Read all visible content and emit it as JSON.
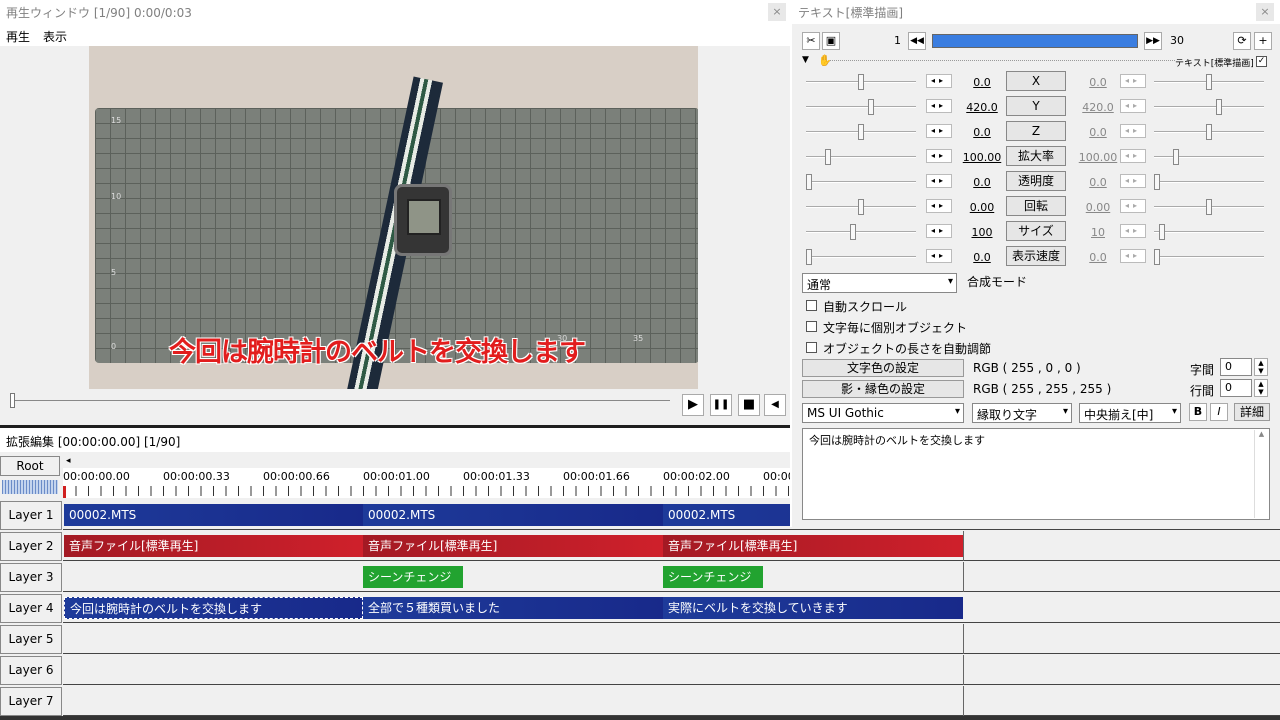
{
  "play_window": {
    "title": "再生ウィンドウ [1/90]  0:00/0:03",
    "close": "×",
    "menu": [
      "再生",
      "表示"
    ],
    "subtitle": "今回は腕時計のベルトを交換します",
    "controls": {
      "play": "▶",
      "pause": "❚❚",
      "stop": "■",
      "sound": "◀"
    }
  },
  "text_panel": {
    "title": "テキスト[標準描画]",
    "close": "×",
    "frame_start": "1",
    "frame_end": "30",
    "object_label": "テキスト[標準描画]",
    "params": [
      {
        "label": "X",
        "value": "0.0",
        "value2": "0.0",
        "level": 0.5,
        "level2": 0.5
      },
      {
        "label": "Y",
        "value": "420.0",
        "value2": "420.0",
        "level": 0.6,
        "level2": 0.6
      },
      {
        "label": "Z",
        "value": "0.0",
        "value2": "0.0",
        "level": 0.5,
        "level2": 0.5
      },
      {
        "label": "拡大率",
        "value": "100.00",
        "value2": "100.00",
        "level": 0.18,
        "level2": 0.18
      },
      {
        "label": "透明度",
        "value": "0.0",
        "value2": "0.0",
        "level": 0.0,
        "level2": 0.0
      },
      {
        "label": "回転",
        "value": "0.00",
        "value2": "0.00",
        "level": 0.5,
        "level2": 0.5
      },
      {
        "label": "サイズ",
        "value": "100",
        "value2": "10",
        "level": 0.42,
        "level2": 0.05
      },
      {
        "label": "表示速度",
        "value": "0.0",
        "value2": "0.0",
        "level": 0.0,
        "level2": 0.0
      }
    ],
    "blend_mode": "通常",
    "blend_mode_label": "合成モード",
    "checkboxes": [
      "自動スクロール",
      "文字毎に個別オブジェクト",
      "オブジェクトの長さを自動調節"
    ],
    "text_color_button": "文字色の設定",
    "text_color_value": "RGB ( 255 , 0 , 0 )",
    "shadow_color_button": "影・縁色の設定",
    "shadow_color_value": "RGB ( 255 , 255 , 255 )",
    "char_spacing_label": "字間",
    "char_spacing": "0",
    "line_spacing_label": "行間",
    "line_spacing": "0",
    "font": "MS UI Gothic",
    "decoration": "縁取り文字",
    "align": "中央揃え[中]",
    "bold": "B",
    "italic": "I",
    "detail": "詳細",
    "text": "今回は腕時計のベルトを交換します"
  },
  "timeline": {
    "title": "拡張編集 [00:00:00.00] [1/90]",
    "root": "Root",
    "ticks": [
      "00:00:00.00",
      "00:00:00.33",
      "00:00:00.66",
      "00:00:01.00",
      "00:00:01.33",
      "00:00:01.66",
      "00:00:02.00",
      "00:00"
    ],
    "layers": [
      "Layer 1",
      "Layer 2",
      "Layer 3",
      "Layer 4",
      "Layer 5",
      "Layer 6",
      "Layer 7"
    ],
    "clips": {
      "l1": [
        "00002.MTS",
        "00002.MTS",
        "00002.MTS"
      ],
      "l2": [
        "音声ファイル[標準再生]",
        "音声ファイル[標準再生]",
        "音声ファイル[標準再生]"
      ],
      "l3": [
        "シーンチェンジ",
        "シーンチェンジ"
      ],
      "l4": [
        "今回は腕時計のベルトを交換します",
        "全部で５種類買いました",
        "実際にベルトを交換していきます"
      ]
    }
  }
}
